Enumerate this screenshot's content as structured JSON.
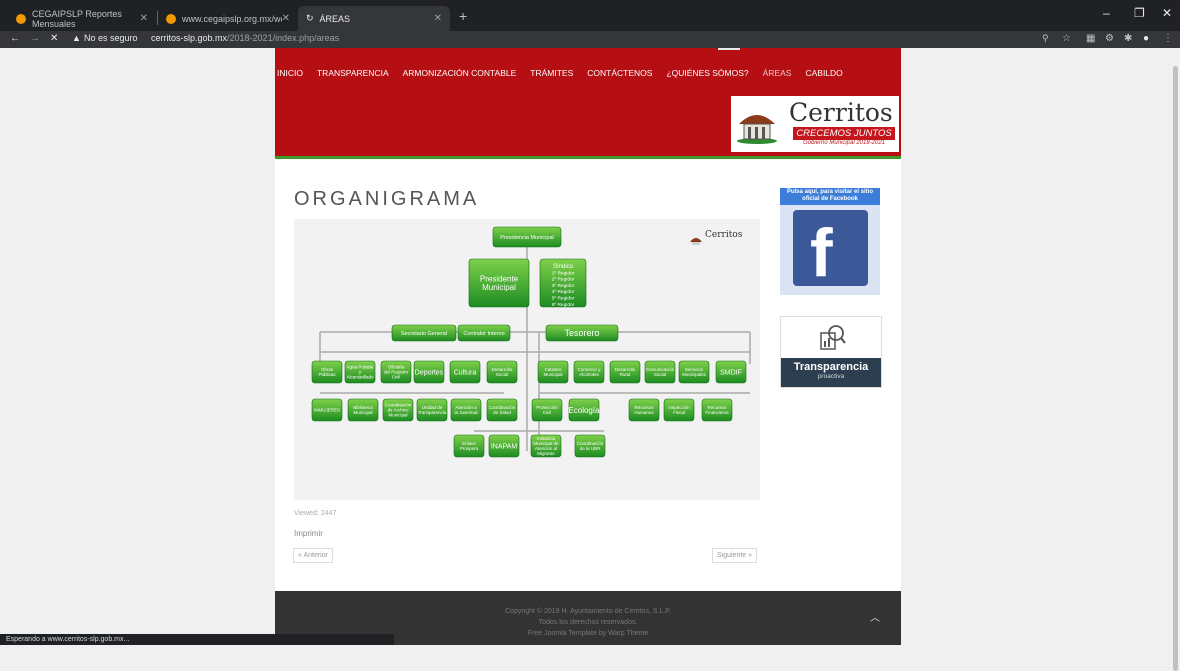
{
  "tabs": [
    {
      "label": "CEGAIPSLP Reportes Mensuales"
    },
    {
      "label": "www.cegaipslp.org.mx/webcega"
    },
    {
      "label": "ÁREAS"
    }
  ],
  "window_controls": {
    "minimize": "–",
    "restore": "❐",
    "close": "✕"
  },
  "address": {
    "security": "No es seguro",
    "host": "cerritos-slp.gob.mx",
    "path": "/2018-2021/index.php/areas"
  },
  "nav": [
    "INICIO",
    "TRANSPARENCIA",
    "ARMONIZACIÓN CONTABLE",
    "TRÁMITES",
    "CONTÁCTENOS",
    "¿QUIÉNES SÓMOS?",
    "ÁREAS",
    "CABILDO"
  ],
  "logo": {
    "name": "Cerritos",
    "slogan": "CRECEMOS JUNTOS",
    "period": "Gobierno Municipal 2018-2021"
  },
  "page_title": "ORGANIGRAMA",
  "orgchart": {
    "watermark": "Cerritos",
    "top": "Presidencia Municipal",
    "president": "Presidente Municipal",
    "sindico": [
      "Síndico",
      "1º Regidor",
      "2º Regidor",
      "3º Regidor",
      "4º Regidor",
      "5º Regidor",
      "6º Regidor"
    ],
    "secretario": "Secretario General",
    "contralor": "Contralor Interno",
    "tesorero": "Tesorero",
    "row1": [
      "Obras Públicas",
      "Agua Potable y Alcantarillado",
      "Oficialía del Registro Civil",
      "Deportes",
      "Cultura",
      "Desarrollo Social",
      "Catastro Municipal",
      "Comercio y Alcoholes",
      "Desarrollo Rural",
      "Comunicación Social",
      "Servicios Municipales",
      "SMDIF"
    ],
    "row2": [
      "INMUJERES",
      "Biblioteca Municipal",
      "Coordinación de Archivo Municipal",
      "Unidad de Transparencia",
      "Atención a la Juventud",
      "Coordinación de Salud",
      "Protección Civil",
      "Ecología",
      "Recursos Humanos",
      "Inspección Fiscal",
      "Recursos Financieros"
    ],
    "row3": [
      "Enlace Prospera",
      "INAPAM",
      "Instancia Municipal de Atención al Migrante",
      "Coordinación de la UBR"
    ]
  },
  "sidebar": {
    "facebook_caption": "Pulsa aquí, para visitar el sitio oficial de Facebook",
    "facebook_icon": "f",
    "transparencia_title": "Transparencia",
    "transparencia_sub": "proactiva"
  },
  "viewed": "Viewed: 2447",
  "imprimir": "Imprimir",
  "prev": "« Anterior",
  "next": "Siguiente »",
  "footer": {
    "line1": "Copyright © 2019 H. Ayuntamiento de Cerritos, S.L.P.",
    "line2": "Todos los derechos reservados.",
    "line3": "Free Joomla Template by Warp Theme"
  },
  "status": "Esperando a www.cerritos-slp.gob.mx..."
}
